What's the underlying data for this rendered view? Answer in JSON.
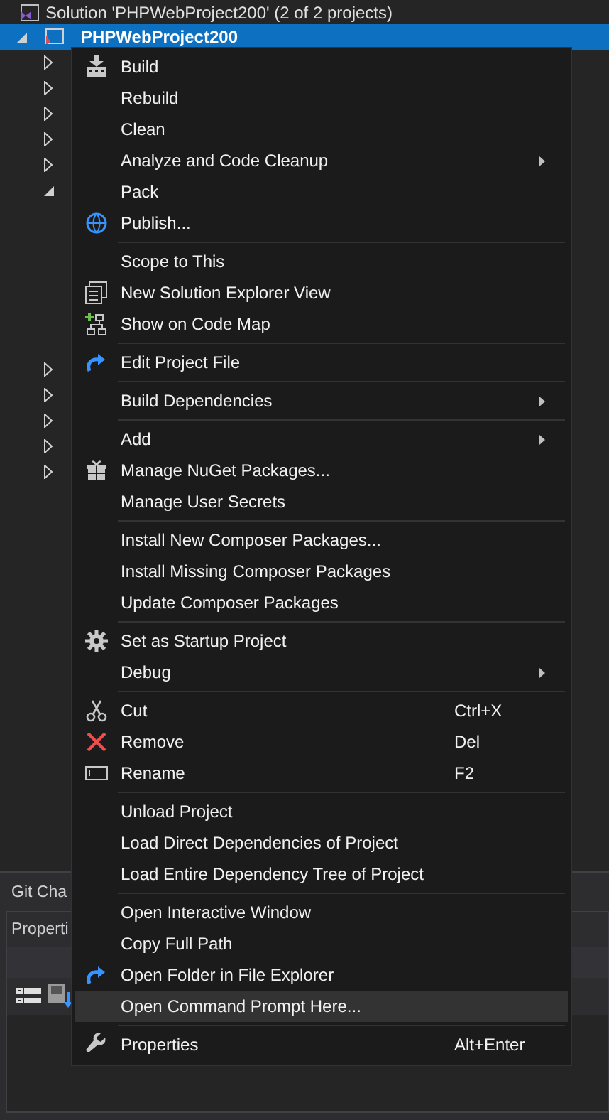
{
  "solution_explorer": {
    "solution": {
      "label": "Solution 'PHPWebProject200' (2 of 2 projects)"
    },
    "project": {
      "label": "PHPWebProject200",
      "selected": true,
      "expanded": true
    },
    "nodes": [
      {
        "expanded": false
      },
      {
        "expanded": false
      },
      {
        "expanded": false
      },
      {
        "expanded": false
      },
      {
        "expanded": false
      },
      {
        "expanded": true
      },
      {
        "expanded": false
      },
      {
        "expanded": false
      },
      {
        "expanded": false
      },
      {
        "expanded": false
      },
      {
        "expanded": false
      }
    ]
  },
  "git_changes_tab": {
    "label": "Git Cha"
  },
  "properties_panel": {
    "title": "Properti"
  },
  "context_menu": {
    "items": [
      {
        "kind": "build",
        "label": "Build",
        "selected": false
      },
      {
        "kind": "plain",
        "label": "Rebuild",
        "selected": false
      },
      {
        "kind": "plain",
        "label": "Clean",
        "selected": false
      },
      {
        "kind": "plain",
        "label": "Analyze and Code Cleanup",
        "submenu": true,
        "selected": false
      },
      {
        "kind": "plain",
        "label": "Pack",
        "selected": false
      },
      {
        "kind": "publish",
        "label": "Publish...",
        "selected": false
      },
      {
        "kind": "separator"
      },
      {
        "kind": "plain",
        "label": "Scope to This",
        "selected": false
      },
      {
        "kind": "view",
        "label": "New Solution Explorer View",
        "selected": false
      },
      {
        "kind": "codemap",
        "label": "Show on Code Map",
        "selected": false
      },
      {
        "kind": "separator"
      },
      {
        "kind": "edit",
        "label": "Edit Project File",
        "selected": false
      },
      {
        "kind": "separator"
      },
      {
        "kind": "plain",
        "label": "Build Dependencies",
        "submenu": true,
        "selected": false
      },
      {
        "kind": "separator"
      },
      {
        "kind": "plain",
        "label": "Add",
        "submenu": true,
        "selected": false
      },
      {
        "kind": "nuget",
        "label": "Manage NuGet Packages...",
        "selected": false
      },
      {
        "kind": "plain",
        "label": "Manage User Secrets",
        "selected": false
      },
      {
        "kind": "separator"
      },
      {
        "kind": "plain",
        "label": "Install New Composer Packages...",
        "selected": false
      },
      {
        "kind": "plain",
        "label": "Install Missing Composer Packages",
        "selected": false
      },
      {
        "kind": "plain",
        "label": "Update Composer Packages",
        "selected": false
      },
      {
        "kind": "separator"
      },
      {
        "kind": "startup",
        "label": "Set as Startup Project",
        "selected": false
      },
      {
        "kind": "plain",
        "label": "Debug",
        "submenu": true,
        "selected": false
      },
      {
        "kind": "separator"
      },
      {
        "kind": "cut",
        "label": "Cut",
        "shortcut": "Ctrl+X",
        "selected": false
      },
      {
        "kind": "remove",
        "label": "Remove",
        "shortcut": "Del",
        "selected": false
      },
      {
        "kind": "rename",
        "label": "Rename",
        "shortcut": "F2",
        "selected": false
      },
      {
        "kind": "separator"
      },
      {
        "kind": "plain",
        "label": "Unload Project",
        "selected": false
      },
      {
        "kind": "plain",
        "label": "Load Direct Dependencies of Project",
        "selected": false
      },
      {
        "kind": "plain",
        "label": "Load Entire Dependency Tree of Project",
        "selected": false
      },
      {
        "kind": "separator"
      },
      {
        "kind": "plain",
        "label": "Open Interactive Window",
        "selected": false
      },
      {
        "kind": "plain",
        "label": "Copy Full Path",
        "selected": false
      },
      {
        "kind": "folder",
        "label": "Open Folder in File Explorer",
        "selected": false
      },
      {
        "kind": "plain",
        "label": "Open Command Prompt Here...",
        "selected": true
      },
      {
        "kind": "separator"
      },
      {
        "kind": "properties",
        "label": "Properties",
        "shortcut": "Alt+Enter",
        "selected": false
      }
    ]
  }
}
